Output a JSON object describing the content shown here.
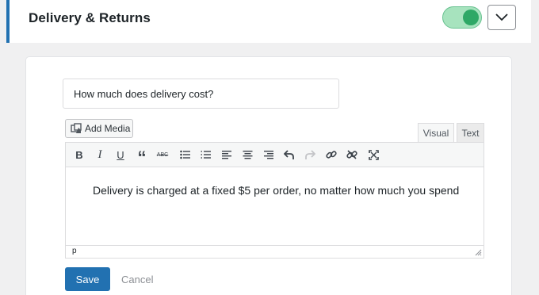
{
  "panel": {
    "title": "Delivery & Returns",
    "toggle_on": true,
    "accent": "#2271b1",
    "toggle_color": "#2ea866"
  },
  "question": {
    "value": "How much does delivery cost?"
  },
  "editor": {
    "add_media_label": "Add Media",
    "tabs": [
      "Visual",
      "Text"
    ],
    "active_tab": "Visual",
    "toolbar": [
      "bold-icon",
      "italic-icon",
      "underline-icon",
      "blockquote-icon",
      "strikethrough-icon",
      "bullet-list-icon",
      "numbered-list-icon",
      "align-left-icon",
      "align-center-icon",
      "align-right-icon",
      "undo-icon",
      "redo-icon",
      "link-icon",
      "unlink-icon",
      "fullscreen-icon"
    ],
    "content": "Delivery is charged at a fixed $5 per order, no matter how much you spend",
    "path": "p"
  },
  "actions": {
    "save_label": "Save",
    "cancel_label": "Cancel"
  }
}
